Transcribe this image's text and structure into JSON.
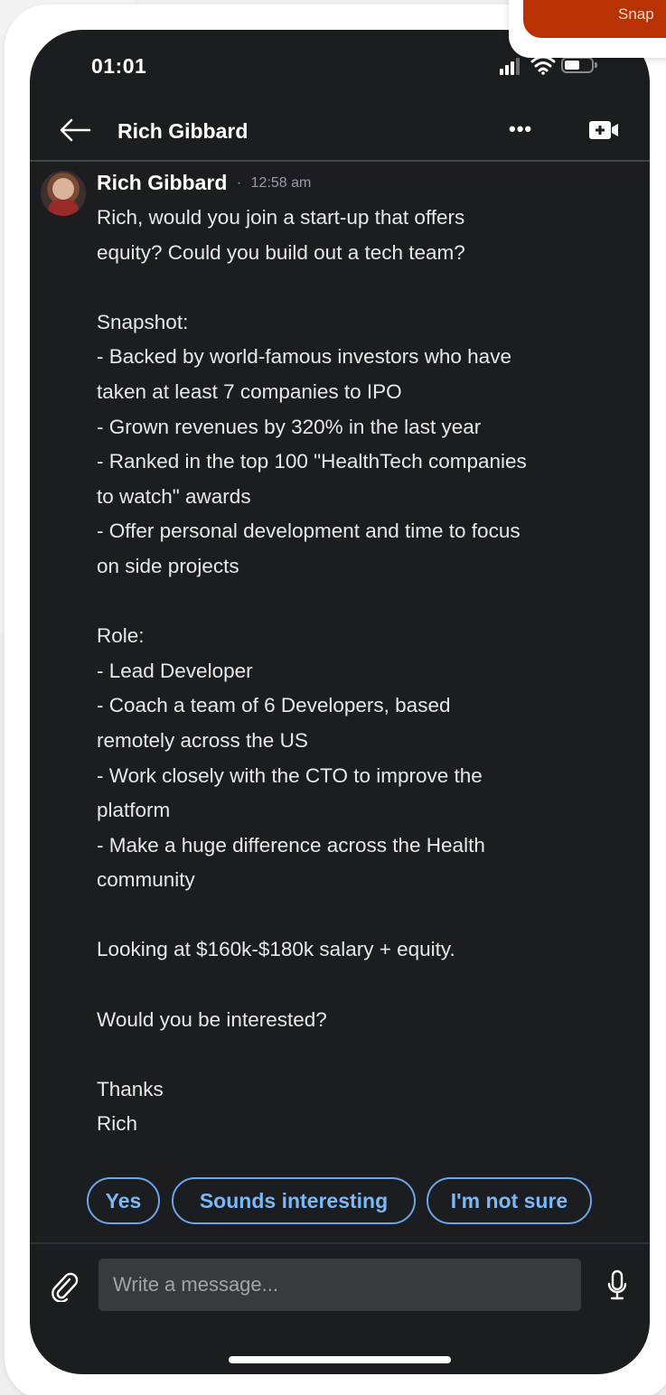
{
  "overlay_card": {
    "text": "Snap"
  },
  "status_bar": {
    "time": "01:01"
  },
  "header": {
    "title": "Rich Gibbard",
    "more": "•••"
  },
  "message": {
    "sender": "Rich Gibbard",
    "separator": "·",
    "time": "12:58 am",
    "lines": [
      "Rich, would you join a start-up that offers",
      "equity? Could you build out a tech team?",
      "",
      "Snapshot:",
      "- Backed by world-famous investors who have",
      "taken at least 7 companies to IPO",
      "- Grown revenues by 320% in the last year",
      "- Ranked in the top 100 \"HealthTech companies",
      "to watch\" awards",
      "- Offer personal development and time to focus",
      "on side projects",
      "",
      "Role:",
      "- Lead Developer",
      "- Coach a team of 6 Developers, based",
      "remotely across the US",
      "- Work closely with the CTO to improve the",
      "platform",
      "- Make a huge difference across the Health",
      "community",
      "",
      "Looking at $160k-$180k salary + equity.",
      "",
      "Would you be interested?",
      "",
      "Thanks",
      "Rich"
    ]
  },
  "quick_replies": [
    "Yes",
    "Sounds interesting",
    "I'm not sure"
  ],
  "composer": {
    "placeholder": "Write a message..."
  },
  "colors": {
    "background": "#1c1d20",
    "accent": "#7cb8f5",
    "divider": "#3c4a45"
  },
  "icons": [
    "back-arrow-icon",
    "more-icon",
    "video-call-icon",
    "paperclip-icon",
    "microphone-icon",
    "signal-icon",
    "wifi-icon",
    "battery-icon"
  ]
}
